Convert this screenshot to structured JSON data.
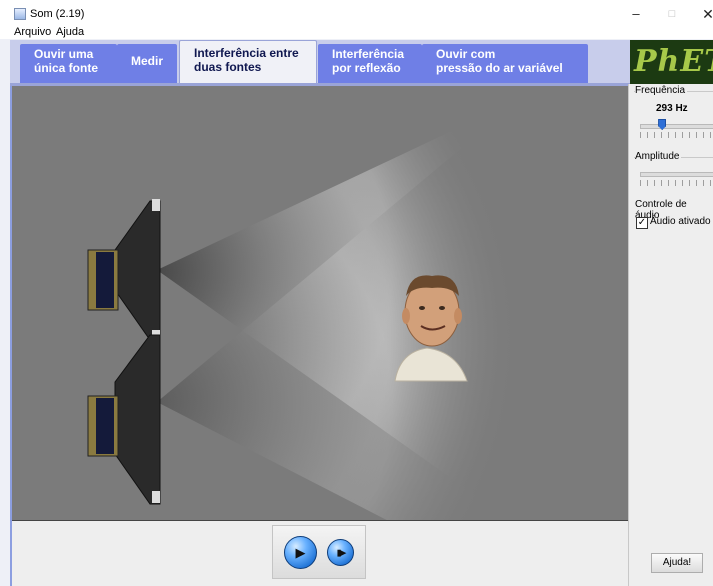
{
  "window": {
    "title": "Som (2.19)",
    "min_icon": "minimize-icon",
    "max_icon": "maximize-icon",
    "close_icon": "close-icon",
    "min_glyph": "–",
    "max_glyph": "□",
    "close_glyph": "✕"
  },
  "menu": [
    "Arquivo",
    "Ajuda"
  ],
  "tabs": [
    {
      "line1": "Ouvir uma",
      "line2": "única fonte",
      "active": false
    },
    {
      "line1": "Medir",
      "line2": "",
      "active": false
    },
    {
      "line1": "Interferência entre",
      "line2": "duas fontes",
      "active": true
    },
    {
      "line1": "Interferência",
      "line2": "por reflexão",
      "active": false
    },
    {
      "line1": "Ouvir com",
      "line2": "pressão do ar variável",
      "active": false
    }
  ],
  "logo": {
    "text": "PhET"
  },
  "controls": {
    "frequency_label": "Frequência",
    "frequency_value": "293 Hz",
    "frequency_level": 0.3,
    "amplitude_label": "Amplitude",
    "amplitude_level": 1.0,
    "audio_group_label": "Controle de áudio",
    "audio_checkbox_label": "Áudio ativado",
    "audio_checked": true,
    "check_glyph": "✓",
    "help_button": "Ajuda!"
  },
  "clock": {
    "play_icon": "play-icon",
    "step_icon": "step-icon",
    "play_glyph": "▶",
    "step_glyph": "▮▶"
  },
  "colors": {
    "tab": "#6f7fe6",
    "tab_active_text": "#101850",
    "sim_background": "#7b7b7b",
    "wave_dark": "#3c3c3c",
    "wave_light": "#cfcfcf",
    "logo_bg": "#1c3a12",
    "logo_text": "#a7c94a",
    "slider_thumb": "#2e6fd6"
  }
}
